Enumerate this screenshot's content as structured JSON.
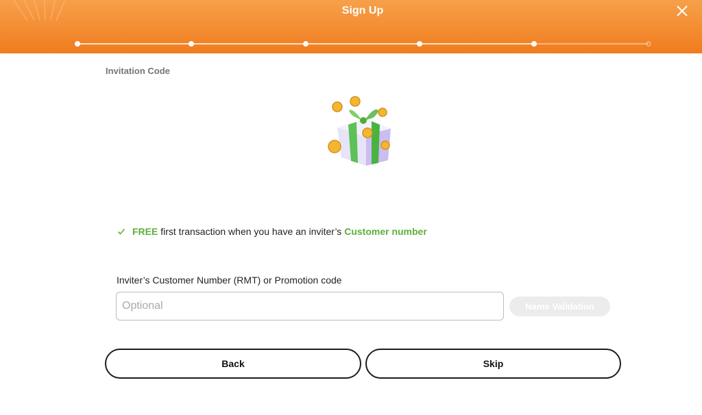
{
  "header": {
    "title": "Sign Up"
  },
  "progress": {
    "total_steps": 6,
    "current_step": 5
  },
  "section": {
    "label": "Invitation Code"
  },
  "benefit": {
    "free": "FREE",
    "middle": " first transaction when you have an inviter’s ",
    "highlight": "Customer number"
  },
  "form": {
    "label": "Inviter’s Customer Number (RMT) or Promotion code",
    "value": "",
    "placeholder": "Optional",
    "validate_label": "Name Validation"
  },
  "actions": {
    "back_label": "Back",
    "skip_label": "Skip"
  },
  "colors": {
    "brand_orange": "#f07c1e",
    "accent_green": "#5fae3a"
  },
  "icons": {
    "close": "close-icon",
    "check": "check-icon",
    "gift": "gift-coins-icon"
  }
}
